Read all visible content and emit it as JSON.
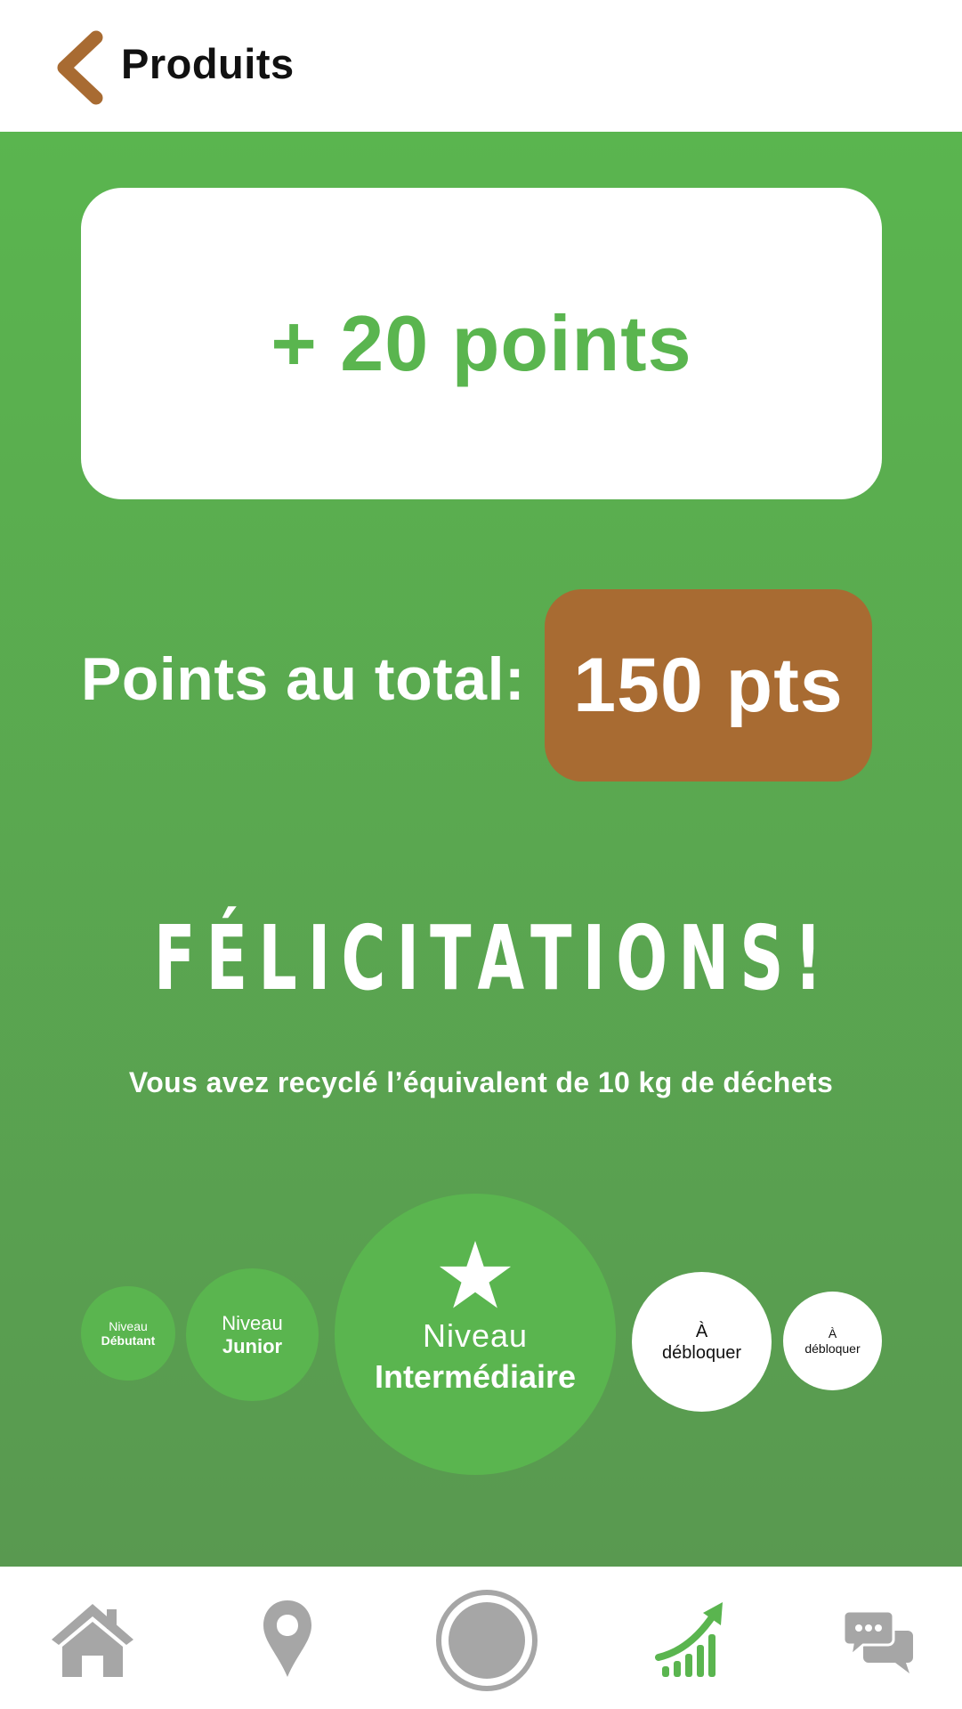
{
  "header": {
    "back_icon": "chevron-left-icon",
    "title": "Produits",
    "accent_color": "#a86b32"
  },
  "reward": {
    "points_earned": "+ 20 points",
    "total_label": "Points au total:",
    "total_value": "150 pts"
  },
  "congrats": {
    "title": "FÉLICITATIONS!",
    "message": "Vous avez recyclé l’équivalent de 10 kg de déchets"
  },
  "levels": [
    {
      "line1": "Niveau",
      "line2": "Débutant",
      "state": "unlocked"
    },
    {
      "line1": "Niveau",
      "line2": "Junior",
      "state": "unlocked"
    },
    {
      "line1": "Niveau",
      "line2": "Intermédiaire",
      "state": "current",
      "icon": "star-icon"
    },
    {
      "line1": "À",
      "line2": "débloquer",
      "state": "locked"
    },
    {
      "line1": "À",
      "line2": "débloquer",
      "state": "locked"
    }
  ],
  "bottom_nav": {
    "items": [
      {
        "icon": "home-icon",
        "active": false
      },
      {
        "icon": "map-pin-icon",
        "active": false
      },
      {
        "icon": "camera-shutter-icon",
        "active": false
      },
      {
        "icon": "growth-chart-icon",
        "active": true
      },
      {
        "icon": "chat-icon",
        "active": false
      }
    ]
  },
  "colors": {
    "green": "#5ab54f",
    "green_dark": "#599950",
    "brown": "#a86b32",
    "nav_gray": "#a6a6a6"
  }
}
